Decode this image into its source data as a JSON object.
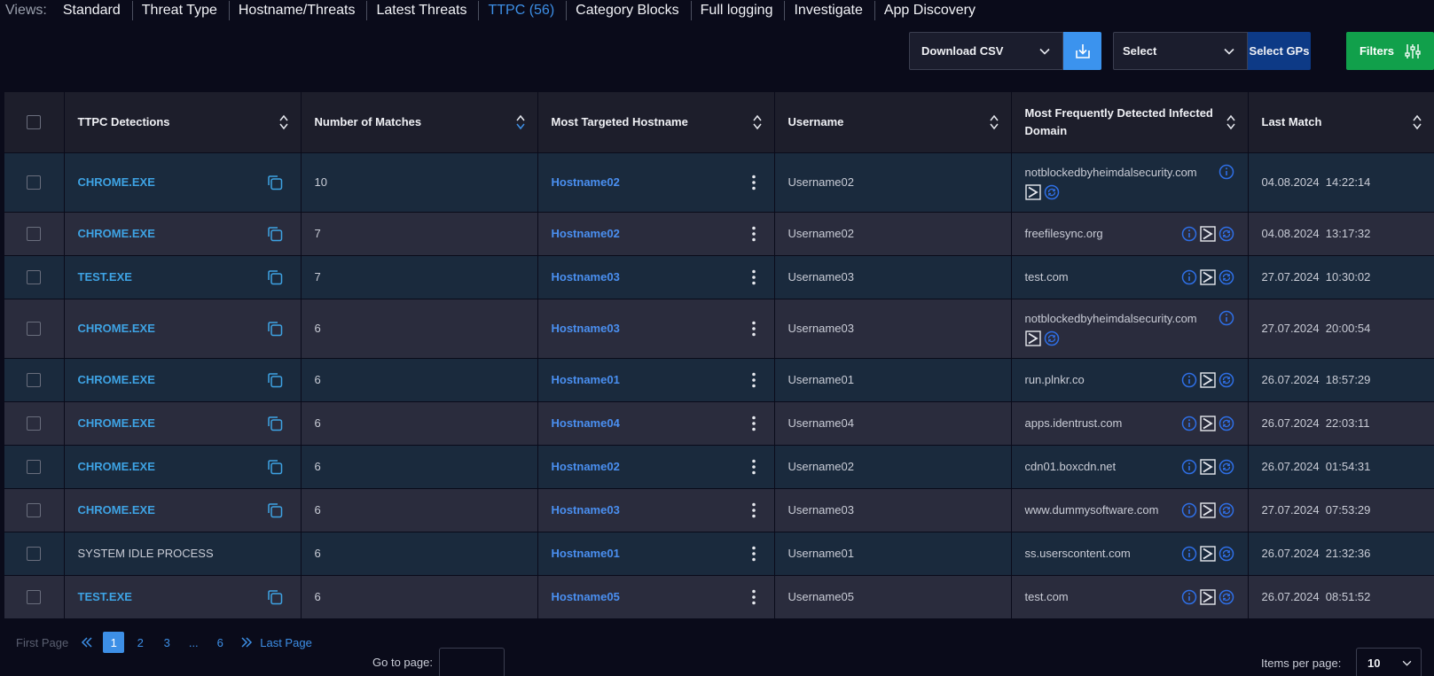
{
  "views": {
    "label": "Views:",
    "items": [
      {
        "label": "Standard",
        "active": false
      },
      {
        "label": "Threat Type",
        "active": false
      },
      {
        "label": "Hostname/Threats",
        "active": false
      },
      {
        "label": "Latest Threats",
        "active": false
      },
      {
        "label": "TTPC (56)",
        "active": true
      },
      {
        "label": "Category Blocks",
        "active": false
      },
      {
        "label": "Full logging",
        "active": false
      },
      {
        "label": "Investigate",
        "active": false
      },
      {
        "label": "App Discovery",
        "active": false
      }
    ]
  },
  "toolbar": {
    "download_label": "Download CSV",
    "select_label": "Select",
    "select_gps_label": "Select GPs",
    "filters_label": "Filters"
  },
  "table": {
    "columns": [
      "TTPC Detections",
      "Number of Matches",
      "Most Targeted Hostname",
      "Username",
      "Most Frequently Detected Infected Domain",
      "Last Match"
    ],
    "rows": [
      {
        "process": "CHROME.EXE",
        "linked": true,
        "matches": "10",
        "hostname": "Hostname02",
        "username": "Username02",
        "domain": "notblockedbyheimdalsecurity.com",
        "wrap": true,
        "last_match": "04.08.2024  14:22:14"
      },
      {
        "process": "CHROME.EXE",
        "linked": true,
        "matches": "7",
        "hostname": "Hostname02",
        "username": "Username02",
        "domain": "freefilesync.org",
        "wrap": false,
        "last_match": "04.08.2024  13:17:32"
      },
      {
        "process": "TEST.EXE",
        "linked": true,
        "matches": "7",
        "hostname": "Hostname03",
        "username": "Username03",
        "domain": "test.com",
        "wrap": false,
        "last_match": "27.07.2024  10:30:02"
      },
      {
        "process": "CHROME.EXE",
        "linked": true,
        "matches": "6",
        "hostname": "Hostname03",
        "username": "Username03",
        "domain": "notblockedbyheimdalsecurity.com",
        "wrap": true,
        "last_match": "27.07.2024  20:00:54"
      },
      {
        "process": "CHROME.EXE",
        "linked": true,
        "matches": "6",
        "hostname": "Hostname01",
        "username": "Username01",
        "domain": "run.plnkr.co",
        "wrap": false,
        "last_match": "26.07.2024  18:57:29"
      },
      {
        "process": "CHROME.EXE",
        "linked": true,
        "matches": "6",
        "hostname": "Hostname04",
        "username": "Username04",
        "domain": "apps.identrust.com",
        "wrap": false,
        "last_match": "26.07.2024  22:03:11"
      },
      {
        "process": "CHROME.EXE",
        "linked": true,
        "matches": "6",
        "hostname": "Hostname02",
        "username": "Username02",
        "domain": "cdn01.boxcdn.net",
        "wrap": false,
        "last_match": "26.07.2024  01:54:31"
      },
      {
        "process": "CHROME.EXE",
        "linked": true,
        "matches": "6",
        "hostname": "Hostname03",
        "username": "Username03",
        "domain": "www.dummysoftware.com",
        "wrap": false,
        "last_match": "27.07.2024  07:53:29"
      },
      {
        "process": "SYSTEM IDLE PROCESS",
        "linked": false,
        "matches": "6",
        "hostname": "Hostname01",
        "username": "Username01",
        "domain": "ss.userscontent.com",
        "wrap": false,
        "last_match": "26.07.2024  21:32:36"
      },
      {
        "process": "TEST.EXE",
        "linked": true,
        "matches": "6",
        "hostname": "Hostname05",
        "username": "Username05",
        "domain": "test.com",
        "wrap": false,
        "last_match": "26.07.2024  08:51:52"
      }
    ]
  },
  "pagination": {
    "first_label": "First Page",
    "pages": [
      "1",
      "2",
      "3",
      "...",
      "6"
    ],
    "active_page": "1",
    "last_label": "Last Page",
    "goto_label": "Go to page:",
    "items_per_page_label": "Items per page:",
    "items_per_page_value": "10"
  },
  "colors": {
    "background": "#0a0b1a",
    "accent": "#3d8fe6",
    "process_link": "#3ea3e4",
    "hostname_link": "#4a8ff0",
    "filters_green": "#11a04b",
    "select_gps_blue": "#0d3a86",
    "row_odd": "#1a2a3d",
    "row_even": "#2a2c3d"
  }
}
